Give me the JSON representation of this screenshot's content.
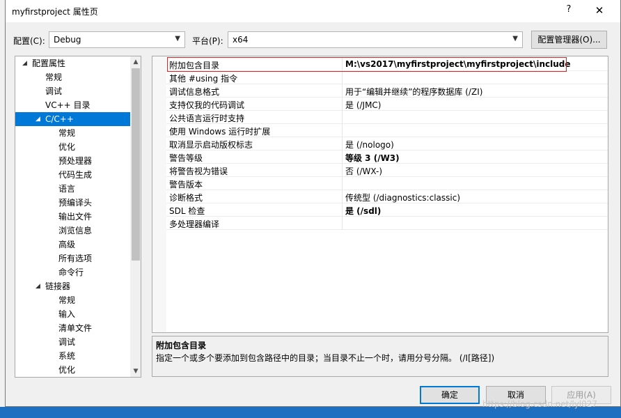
{
  "window": {
    "title": "myfirstproject 属性页",
    "help_glyph": "?",
    "close_glyph": "✕"
  },
  "config": {
    "config_label": "配置(C):",
    "config_value": "Debug",
    "platform_label": "平台(P):",
    "platform_value": "x64",
    "manager_button": "配置管理器(O)..."
  },
  "tree": {
    "items": [
      {
        "label": "配置属性",
        "level": 0,
        "expander": "◢"
      },
      {
        "label": "常规",
        "level": 1
      },
      {
        "label": "调试",
        "level": 1
      },
      {
        "label": "VC++ 目录",
        "level": 1
      },
      {
        "label": "C/C++",
        "level": 1,
        "expander": "◢",
        "selected": true
      },
      {
        "label": "常规",
        "level": 2
      },
      {
        "label": "优化",
        "level": 2
      },
      {
        "label": "预处理器",
        "level": 2
      },
      {
        "label": "代码生成",
        "level": 2
      },
      {
        "label": "语言",
        "level": 2
      },
      {
        "label": "预编译头",
        "level": 2
      },
      {
        "label": "输出文件",
        "level": 2
      },
      {
        "label": "浏览信息",
        "level": 2
      },
      {
        "label": "高级",
        "level": 2
      },
      {
        "label": "所有选项",
        "level": 2
      },
      {
        "label": "命令行",
        "level": 2
      },
      {
        "label": "链接器",
        "level": 1,
        "expander": "◢"
      },
      {
        "label": "常规",
        "level": 2
      },
      {
        "label": "输入",
        "level": 2
      },
      {
        "label": "清单文件",
        "level": 2
      },
      {
        "label": "调试",
        "level": 2
      },
      {
        "label": "系统",
        "level": 2
      },
      {
        "label": "优化",
        "level": 2
      }
    ]
  },
  "properties": [
    {
      "name": "附加包含目录",
      "value": "M:\\vs2017\\myfirstproject\\myfirstproject\\include",
      "bold": true
    },
    {
      "name": "其他 #using 指令",
      "value": ""
    },
    {
      "name": "调试信息格式",
      "value": "用于“编辑并继续”的程序数据库 (/ZI)"
    },
    {
      "name": "支持仅我的代码调试",
      "value": "是 (/JMC)"
    },
    {
      "name": "公共语言运行时支持",
      "value": ""
    },
    {
      "name": "使用 Windows 运行时扩展",
      "value": ""
    },
    {
      "name": "取消显示启动版权标志",
      "value": "是 (/nologo)"
    },
    {
      "name": "警告等级",
      "value": "等级 3 (/W3)",
      "bold": true
    },
    {
      "name": "将警告视为错误",
      "value": "否 (/WX-)"
    },
    {
      "name": "警告版本",
      "value": ""
    },
    {
      "name": "诊断格式",
      "value": "传统型 (/diagnostics:classic)"
    },
    {
      "name": "SDL 检查",
      "value": "是 (/sdl)",
      "bold": true
    },
    {
      "name": "多处理器编译",
      "value": ""
    }
  ],
  "description": {
    "title": "附加包含目录",
    "text": "指定一个或多个要添加到包含路径中的目录；当目录不止一个时，请用分号分隔。     (/I[路径])"
  },
  "buttons": {
    "ok": "确定",
    "cancel": "取消",
    "apply": "应用(A)"
  },
  "watermark": "https://blog.csdn.net/lyl027",
  "colors": {
    "selection": "#0078d7",
    "highlight_box": "#e02020"
  }
}
